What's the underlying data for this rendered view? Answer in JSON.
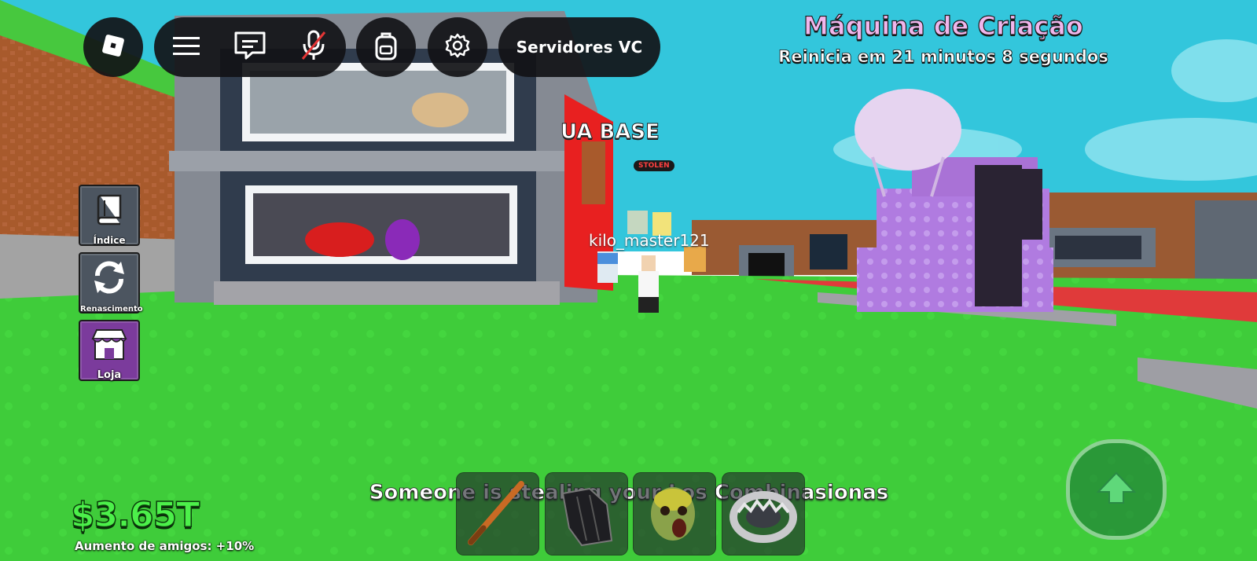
{
  "hud": {
    "roblox_icon": "roblox-logo-icon",
    "menu_icon": "hamburger-menu-icon",
    "chat_icon": "chat-icon",
    "mic_icon": "microphone-muted-icon",
    "backpack_icon": "backpack-icon",
    "settings_icon": "gear-icon",
    "servers_label": "Servidores VC"
  },
  "event": {
    "title": "Máquina de Criação",
    "timer": "Reinicia em 21 minutos 8 segundos"
  },
  "side_menu": [
    {
      "label": "Índice",
      "icon": "book-icon"
    },
    {
      "label": "Renascimento",
      "icon": "rebirth-arrows-icon"
    },
    {
      "label": "Loja",
      "icon": "shop-storefront-icon"
    }
  ],
  "stats": {
    "money": "$3.65T",
    "friends_boost": "Aumento de amigos: +10%"
  },
  "notice": "Someone is stealing your Los Combinasionas",
  "world": {
    "player_name": "kilo_master121",
    "base_sign": "UA BASE",
    "stolen_tag": "STOLEN"
  },
  "hotbar": [
    {
      "item": "bat-icon"
    },
    {
      "item": "glove-icon"
    },
    {
      "item": "zombie-mask-icon"
    },
    {
      "item": "bear-trap-icon"
    }
  ],
  "jump_icon": "jump-arrow-icon",
  "colors": {
    "grass": "#3fcc3a",
    "sky": "#33c6dc",
    "money_green": "#4cf04a",
    "event_pink": "#f0b6ec",
    "shop_purple": "#7b3b9c"
  }
}
